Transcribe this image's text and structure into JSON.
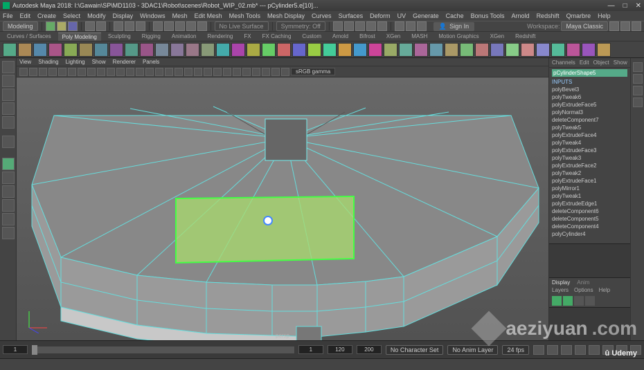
{
  "title": "Autodesk Maya 2018: I:\\Gawain\\SP\\MD1103 - 3DAC1\\Robot\\scenes\\Robot_WIP_02.mb*  ---  pCylinder5.e[10]...",
  "win_controls": {
    "min": "—",
    "max": "□",
    "close": "✕"
  },
  "menus": [
    "File",
    "Edit",
    "Create",
    "Select",
    "Modify",
    "Display",
    "Windows",
    "Mesh",
    "Edit Mesh",
    "Mesh Tools",
    "Mesh Display",
    "Curves",
    "Surfaces",
    "Deform",
    "UV",
    "Generate",
    "Cache",
    "Bonus Tools",
    "Arnold",
    "Redshift",
    "Qmarbre",
    "Help"
  ],
  "workspace_label": "Workspace:",
  "workspace_value": "Maya Classic",
  "module_dropdown": "Modeling",
  "no_live_surface": "No Live Surface",
  "symmetry": "Symmetry: Off",
  "sign_in": "Sign In",
  "shelf_tabs": [
    "Curves / Surfaces",
    "Poly Modeling",
    "Sculpting",
    "Rigging",
    "Animation",
    "Rendering",
    "FX",
    "FX Caching",
    "Custom",
    "Arnold",
    "Bifrost",
    "XGen",
    "MASH",
    "Motion Graphics",
    "XGen",
    "Redshift"
  ],
  "shelf_active": 1,
  "panel_menus": [
    "View",
    "Shading",
    "Lighting",
    "Show",
    "Renderer",
    "Panels"
  ],
  "color_mgmt": "sRGB gamma",
  "camera_label": "persp",
  "channel_tabs": [
    "Channels",
    "Edit",
    "Object",
    "Show"
  ],
  "history_title": "pCylinderShape5",
  "history_section": "INPUTS",
  "history": [
    "polyBevel3",
    "polyTweak6",
    "polyExtrudeFace5",
    "polyNormal3",
    "deleteComponent7",
    "polyTweak5",
    "polyExtrudeFace4",
    "polyTweak4",
    "polyExtrudeFace3",
    "polyTweak3",
    "polyExtrudeFace2",
    "polyTweak2",
    "polyExtrudeFace1",
    "polyMirror1",
    "polyTweak1",
    "polyExtrudeEdge1",
    "deleteComponent6",
    "deleteComponent5",
    "deleteComponent4",
    "polyCylinder4"
  ],
  "display_label": "Display",
  "anim_label": "Anim",
  "layer_tabs": [
    "Layers",
    "Options",
    "Help"
  ],
  "timeline": {
    "start": "1",
    "startRange": "1",
    "end": "120",
    "endRange": "200",
    "current": "1"
  },
  "no_char_set": "No Character Set",
  "no_anim_layer": "No Anim Layer",
  "fps": "24 fps",
  "watermark": "aeziyuan",
  "watermark_suffix": ".com",
  "udemy": "Udemy"
}
